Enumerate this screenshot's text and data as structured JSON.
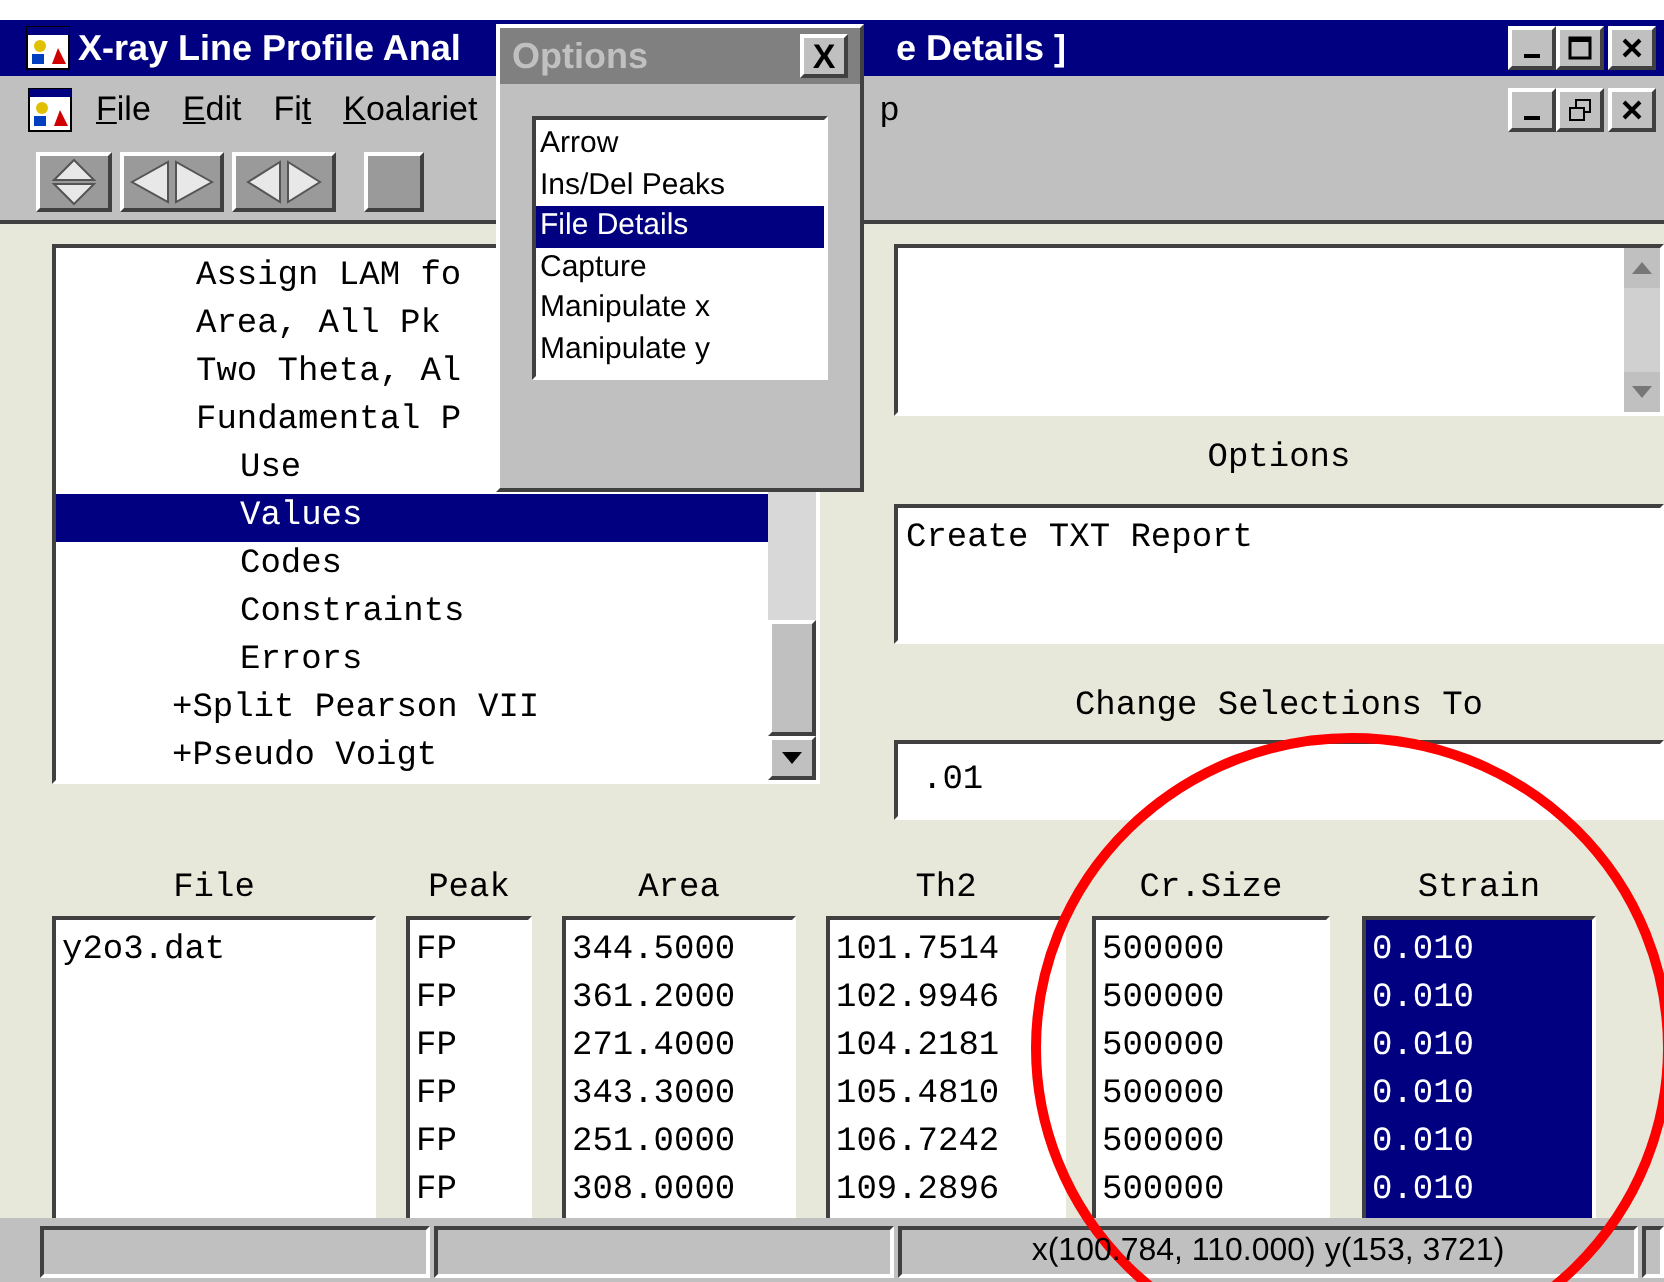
{
  "window": {
    "title_left": "X-ray Line Profile Anal",
    "title_right": "e Details ]"
  },
  "menu": {
    "items": [
      {
        "key": "F",
        "after": "ile"
      },
      {
        "key": "E",
        "after": "dit"
      },
      {
        "before": "Fi",
        "key": "t"
      },
      {
        "key": "K",
        "after": "oalariet"
      }
    ],
    "tail": "p"
  },
  "toolbar": {
    "buttons": [
      {
        "kind": "updown"
      },
      {
        "kind": "leftright"
      },
      {
        "kind": "triangles"
      },
      {
        "kind": "square"
      }
    ]
  },
  "tree": {
    "items": [
      {
        "children": [
          {
            "label": "Assign LAM fo",
            "selected": false
          },
          {
            "label": "Area, All Pk",
            "selected": false
          },
          {
            "label": "Two Theta, Al",
            "selected": false
          },
          {
            "label": "Fundamental P",
            "selected": false,
            "children": [
              {
                "label": "Use",
                "selected": false
              },
              {
                "label": "Values",
                "selected": true
              },
              {
                "label": "Codes",
                "selected": false
              },
              {
                "label": "Constraints",
                "selected": false
              },
              {
                "label": "Errors",
                "selected": false
              }
            ]
          }
        ]
      },
      {
        "label": "+Split Pearson VII",
        "selected": false
      },
      {
        "label": "+Pseudo Voigt",
        "selected": false
      }
    ]
  },
  "options_popup": {
    "title": "Options",
    "close": "X",
    "items": [
      {
        "label": "Arrow",
        "selected": false
      },
      {
        "label": "Ins/Del Peaks",
        "selected": false
      },
      {
        "label": "File Details",
        "selected": true
      },
      {
        "label": "Capture",
        "selected": false
      },
      {
        "label": "Manipulate x",
        "selected": false
      },
      {
        "label": "Manipulate y",
        "selected": false
      }
    ]
  },
  "options": {
    "label": "Options",
    "items": [
      "Create TXT Report"
    ]
  },
  "change": {
    "label": "Change Selections To",
    "value": ".01"
  },
  "columns": [
    {
      "heading": "File",
      "selected": false,
      "rows": [
        "y2o3.dat"
      ]
    },
    {
      "heading": "Peak",
      "selected": false,
      "rows": [
        "FP",
        "FP",
        "FP",
        "FP",
        "FP",
        "FP"
      ]
    },
    {
      "heading": "Area",
      "selected": false,
      "rows": [
        "344.5000",
        "361.2000",
        "271.4000",
        "343.3000",
        "251.0000",
        "308.0000"
      ]
    },
    {
      "heading": "Th2",
      "selected": false,
      "rows": [
        "101.7514",
        "102.9946",
        "104.2181",
        "105.4810",
        "106.7242",
        "109.2896"
      ]
    },
    {
      "heading": "Cr.Size",
      "selected": false,
      "rows": [
        "500000",
        "500000",
        "500000",
        "500000",
        "500000",
        "500000"
      ]
    },
    {
      "heading": "Strain",
      "selected": true,
      "rows": [
        "0.010",
        "0.010",
        "0.010",
        "0.010",
        "0.010",
        "0.010"
      ]
    }
  ],
  "status_bar": {
    "panels": [
      {
        "kind": "empty"
      },
      {
        "kind": "empty"
      },
      {
        "kind": "text",
        "text": "x(100.784, 110.000) y(153, 3721)"
      },
      {
        "kind": "empty"
      }
    ]
  }
}
